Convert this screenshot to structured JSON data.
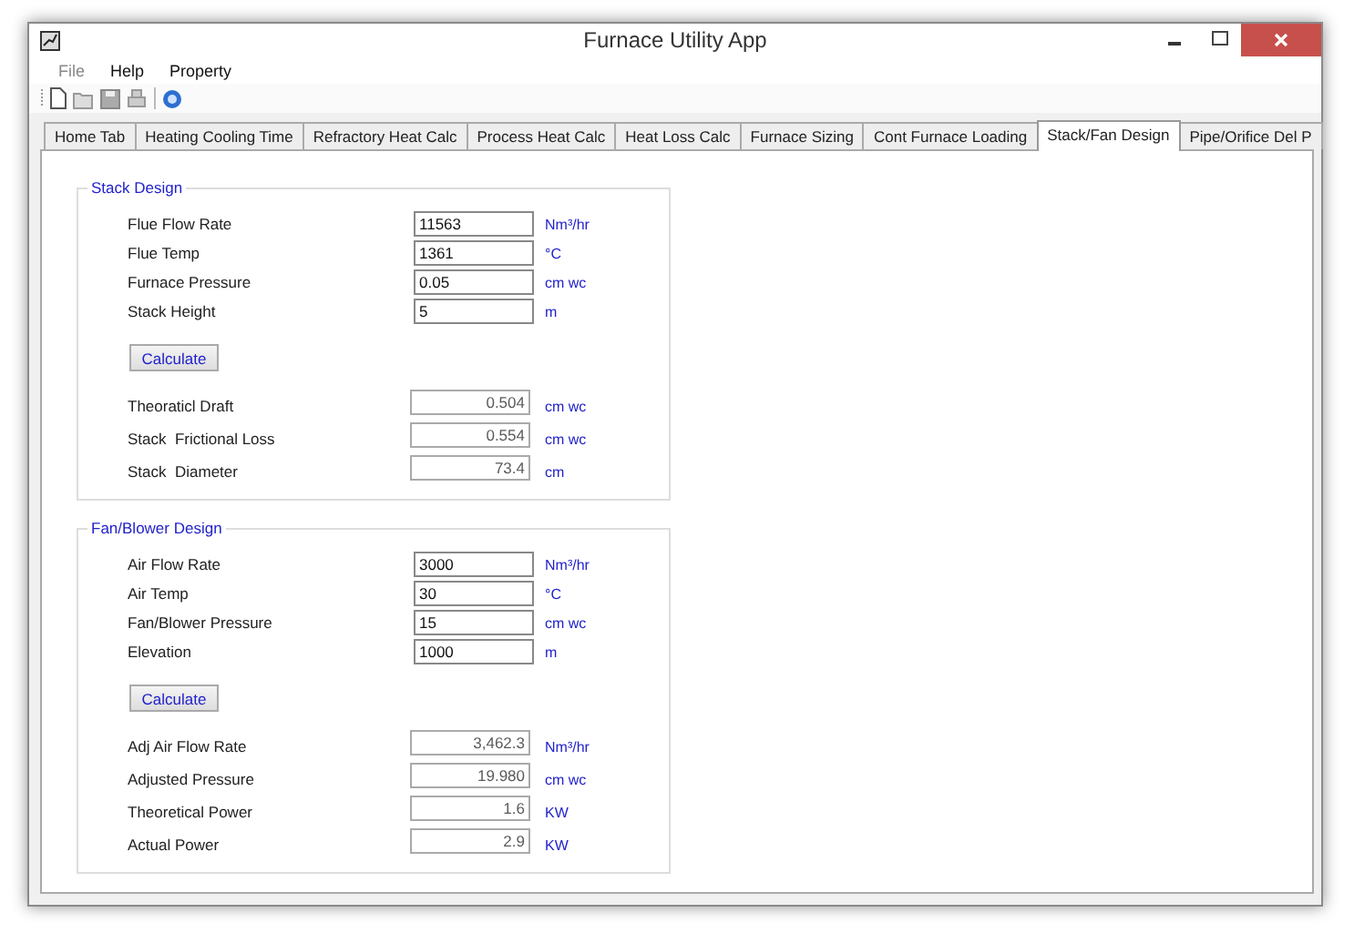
{
  "window": {
    "title": "Furnace Utility App"
  },
  "menu": [
    {
      "label": "File",
      "disabled": true
    },
    {
      "label": "Help",
      "disabled": false
    },
    {
      "label": "Property",
      "disabled": false
    }
  ],
  "tabs": [
    {
      "label": "Home Tab",
      "selected": false
    },
    {
      "label": "Heating Cooling Time",
      "selected": false
    },
    {
      "label": "Refractory Heat Calc",
      "selected": false
    },
    {
      "label": "Process Heat Calc",
      "selected": false
    },
    {
      "label": "Heat Loss Calc",
      "selected": false
    },
    {
      "label": "Furnace Sizing",
      "selected": false
    },
    {
      "label": "Cont Furnace Loading",
      "selected": false
    },
    {
      "label": "Stack/Fan Design",
      "selected": true
    },
    {
      "label": "Pipe/Orifice Del P",
      "selected": false
    }
  ],
  "groups": [
    {
      "title": "Stack Design",
      "inputs": [
        {
          "label": "Flue Flow Rate",
          "value": "11563",
          "unit": "Nm³/hr"
        },
        {
          "label": "Flue Temp",
          "value": "1361",
          "unit": "°C"
        },
        {
          "label": "Furnace Pressure",
          "value": "0.05",
          "unit": "cm wc"
        },
        {
          "label": "Stack Height",
          "value": "5",
          "unit": "m"
        }
      ],
      "button": "Calculate",
      "outputs": [
        {
          "label": "Theoraticl Draft",
          "value": "0.504",
          "unit": "cm wc"
        },
        {
          "label": "Stack  Frictional Loss",
          "value": "0.554",
          "unit": "cm wc"
        },
        {
          "label": "Stack  Diameter",
          "value": "73.4",
          "unit": "cm"
        }
      ]
    },
    {
      "title": "Fan/Blower Design",
      "inputs": [
        {
          "label": "Air Flow Rate",
          "value": "3000",
          "unit": "Nm³/hr"
        },
        {
          "label": "Air Temp",
          "value": "30",
          "unit": "°C"
        },
        {
          "label": "Fan/Blower Pressure",
          "value": "15",
          "unit": "cm wc"
        },
        {
          "label": "Elevation",
          "value": "1000",
          "unit": "m"
        }
      ],
      "button": "Calculate",
      "outputs": [
        {
          "label": "Adj Air Flow Rate",
          "value": "3,462.3",
          "unit": "Nm³/hr"
        },
        {
          "label": "Adjusted Pressure",
          "value": "19.980",
          "unit": "cm wc"
        },
        {
          "label": "Theoretical Power",
          "value": "1.6",
          "unit": "KW"
        },
        {
          "label": "Actual Power",
          "value": "2.9",
          "unit": "KW"
        }
      ]
    }
  ]
}
